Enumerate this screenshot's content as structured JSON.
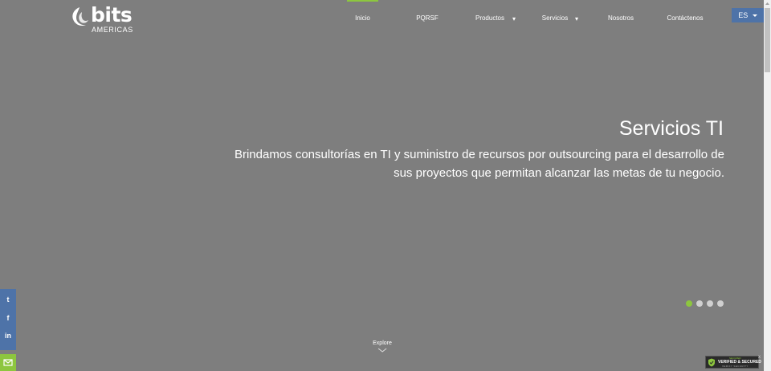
{
  "brand": {
    "name": "bits",
    "subtitle": "AMERICAS"
  },
  "nav": {
    "items": [
      {
        "label": "Inicio",
        "active": true
      },
      {
        "label": "PQRSF"
      },
      {
        "label": "Productos",
        "dropdown": true
      },
      {
        "label": "Servicios",
        "dropdown": true
      },
      {
        "label": "Nosotros"
      },
      {
        "label": "Contáctenos"
      }
    ]
  },
  "language": {
    "label": "ES"
  },
  "hero": {
    "title": "Servicios TI",
    "description": "Brindamos consultorías en TI y suministro de recursos por outsourcing para el desarrollo de sus proyectos que permitan alcanzar las metas de tu negocio."
  },
  "carousel": {
    "slides": 4,
    "active_index": 0
  },
  "explore": {
    "label": "Explore"
  },
  "social": {
    "twitter": "t",
    "facebook": "f",
    "linkedin": "in"
  },
  "badge": {
    "top": "SECURED",
    "main": "VERIFIED & SECURED",
    "sub": "VERIFY SECURITY",
    "close": "x"
  },
  "colors": {
    "background": "#7e7e7e",
    "accent_green": "#8dc63f",
    "accent_blue": "#4e73a8"
  }
}
